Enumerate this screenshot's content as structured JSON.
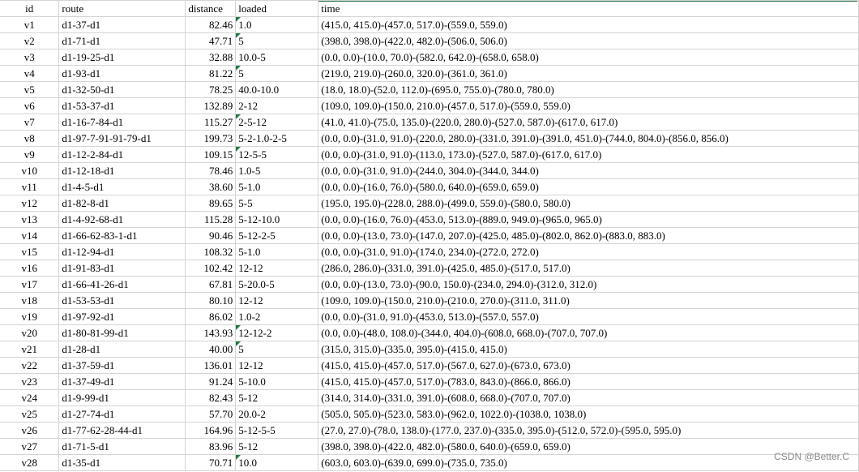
{
  "columns": {
    "id": "id",
    "route": "route",
    "distance": "distance",
    "loaded": "loaded",
    "time": "time"
  },
  "rows": [
    {
      "id": "v1",
      "route": "d1-37-d1",
      "distance": "82.46",
      "loaded": "1.0",
      "time": "(415.0, 415.0)-(457.0, 517.0)-(559.0, 559.0)",
      "flag": true
    },
    {
      "id": "v2",
      "route": "d1-71-d1",
      "distance": "47.71",
      "loaded": "5",
      "time": "(398.0, 398.0)-(422.0, 482.0)-(506.0, 506.0)",
      "flag": true
    },
    {
      "id": "v3",
      "route": "d1-19-25-d1",
      "distance": "32.88",
      "loaded": "10.0-5",
      "time": "(0.0, 0.0)-(10.0, 70.0)-(582.0, 642.0)-(658.0, 658.0)",
      "flag": false
    },
    {
      "id": "v4",
      "route": "d1-93-d1",
      "distance": "81.22",
      "loaded": "5",
      "time": "(219.0, 219.0)-(260.0, 320.0)-(361.0, 361.0)",
      "flag": true
    },
    {
      "id": "v5",
      "route": "d1-32-50-d1",
      "distance": "78.25",
      "loaded": "40.0-10.0",
      "time": "(18.0, 18.0)-(52.0, 112.0)-(695.0, 755.0)-(780.0, 780.0)",
      "flag": false
    },
    {
      "id": "v6",
      "route": "d1-53-37-d1",
      "distance": "132.89",
      "loaded": "2-12",
      "time": "(109.0, 109.0)-(150.0, 210.0)-(457.0, 517.0)-(559.0, 559.0)",
      "flag": false
    },
    {
      "id": "v7",
      "route": "d1-16-7-84-d1",
      "distance": "115.27",
      "loaded": "2-5-12",
      "time": "(41.0, 41.0)-(75.0, 135.0)-(220.0, 280.0)-(527.0, 587.0)-(617.0, 617.0)",
      "flag": true
    },
    {
      "id": "v8",
      "route": "d1-97-7-91-91-79-d1",
      "distance": "199.73",
      "loaded": "5-2-1.0-2-5",
      "time": "(0.0, 0.0)-(31.0, 91.0)-(220.0, 280.0)-(331.0, 391.0)-(391.0, 451.0)-(744.0, 804.0)-(856.0, 856.0)",
      "flag": false
    },
    {
      "id": "v9",
      "route": "d1-12-2-84-d1",
      "distance": "109.15",
      "loaded": "12-5-5",
      "time": "(0.0, 0.0)-(31.0, 91.0)-(113.0, 173.0)-(527.0, 587.0)-(617.0, 617.0)",
      "flag": true
    },
    {
      "id": "v10",
      "route": "d1-12-18-d1",
      "distance": "78.46",
      "loaded": "1.0-5",
      "time": "(0.0, 0.0)-(31.0, 91.0)-(244.0, 304.0)-(344.0, 344.0)",
      "flag": false
    },
    {
      "id": "v11",
      "route": "d1-4-5-d1",
      "distance": "38.60",
      "loaded": "5-1.0",
      "time": "(0.0, 0.0)-(16.0, 76.0)-(580.0, 640.0)-(659.0, 659.0)",
      "flag": false
    },
    {
      "id": "v12",
      "route": "d1-82-8-d1",
      "distance": "89.65",
      "loaded": "5-5",
      "time": "(195.0, 195.0)-(228.0, 288.0)-(499.0, 559.0)-(580.0, 580.0)",
      "flag": false
    },
    {
      "id": "v13",
      "route": "d1-4-92-68-d1",
      "distance": "115.28",
      "loaded": "5-12-10.0",
      "time": "(0.0, 0.0)-(16.0, 76.0)-(453.0, 513.0)-(889.0, 949.0)-(965.0, 965.0)",
      "flag": false
    },
    {
      "id": "v14",
      "route": "d1-66-62-83-1-d1",
      "distance": "90.46",
      "loaded": "5-12-2-5",
      "time": "(0.0, 0.0)-(13.0, 73.0)-(147.0, 207.0)-(425.0, 485.0)-(802.0, 862.0)-(883.0, 883.0)",
      "flag": false
    },
    {
      "id": "v15",
      "route": "d1-12-94-d1",
      "distance": "108.32",
      "loaded": "5-1.0",
      "time": "(0.0, 0.0)-(31.0, 91.0)-(174.0, 234.0)-(272.0, 272.0)",
      "flag": false
    },
    {
      "id": "v16",
      "route": "d1-91-83-d1",
      "distance": "102.42",
      "loaded": "12-12",
      "time": "(286.0, 286.0)-(331.0, 391.0)-(425.0, 485.0)-(517.0, 517.0)",
      "flag": false
    },
    {
      "id": "v17",
      "route": "d1-66-41-26-d1",
      "distance": "67.81",
      "loaded": "5-20.0-5",
      "time": "(0.0, 0.0)-(13.0, 73.0)-(90.0, 150.0)-(234.0, 294.0)-(312.0, 312.0)",
      "flag": false
    },
    {
      "id": "v18",
      "route": "d1-53-53-d1",
      "distance": "80.10",
      "loaded": "12-12",
      "time": "(109.0, 109.0)-(150.0, 210.0)-(210.0, 270.0)-(311.0, 311.0)",
      "flag": false
    },
    {
      "id": "v19",
      "route": "d1-97-92-d1",
      "distance": "86.02",
      "loaded": "1.0-2",
      "time": "(0.0, 0.0)-(31.0, 91.0)-(453.0, 513.0)-(557.0, 557.0)",
      "flag": false
    },
    {
      "id": "v20",
      "route": "d1-80-81-99-d1",
      "distance": "143.93",
      "loaded": "12-12-2",
      "time": "(0.0, 0.0)-(48.0, 108.0)-(344.0, 404.0)-(608.0, 668.0)-(707.0, 707.0)",
      "flag": true
    },
    {
      "id": "v21",
      "route": "d1-28-d1",
      "distance": "40.00",
      "loaded": "5",
      "time": "(315.0, 315.0)-(335.0, 395.0)-(415.0, 415.0)",
      "flag": true
    },
    {
      "id": "v22",
      "route": "d1-37-59-d1",
      "distance": "136.01",
      "loaded": "12-12",
      "time": "(415.0, 415.0)-(457.0, 517.0)-(567.0, 627.0)-(673.0, 673.0)",
      "flag": false
    },
    {
      "id": "v23",
      "route": "d1-37-49-d1",
      "distance": "91.24",
      "loaded": "5-10.0",
      "time": "(415.0, 415.0)-(457.0, 517.0)-(783.0, 843.0)-(866.0, 866.0)",
      "flag": false
    },
    {
      "id": "v24",
      "route": "d1-9-99-d1",
      "distance": "82.43",
      "loaded": "5-12",
      "time": "(314.0, 314.0)-(331.0, 391.0)-(608.0, 668.0)-(707.0, 707.0)",
      "flag": false
    },
    {
      "id": "v25",
      "route": "d1-27-74-d1",
      "distance": "57.70",
      "loaded": "20.0-2",
      "time": "(505.0, 505.0)-(523.0, 583.0)-(962.0, 1022.0)-(1038.0, 1038.0)",
      "flag": false
    },
    {
      "id": "v26",
      "route": "d1-77-62-28-44-d1",
      "distance": "164.96",
      "loaded": "5-12-5-5",
      "time": "(27.0, 27.0)-(78.0, 138.0)-(177.0, 237.0)-(335.0, 395.0)-(512.0, 572.0)-(595.0, 595.0)",
      "flag": false
    },
    {
      "id": "v27",
      "route": "d1-71-5-d1",
      "distance": "83.96",
      "loaded": "5-12",
      "time": "(398.0, 398.0)-(422.0, 482.0)-(580.0, 640.0)-(659.0, 659.0)",
      "flag": false
    },
    {
      "id": "v28",
      "route": "d1-35-d1",
      "distance": "70.71",
      "loaded": "10.0",
      "time": "(603.0, 603.0)-(639.0, 699.0)-(735.0, 735.0)",
      "flag": true
    }
  ],
  "watermark": "CSDN @Better.C",
  "colors": {
    "grid_line": "#d4d4d4",
    "error_flag": "#1f7a3e",
    "selection": "#217346"
  },
  "icons": {
    "error_flag": "green-triangle-icon"
  }
}
